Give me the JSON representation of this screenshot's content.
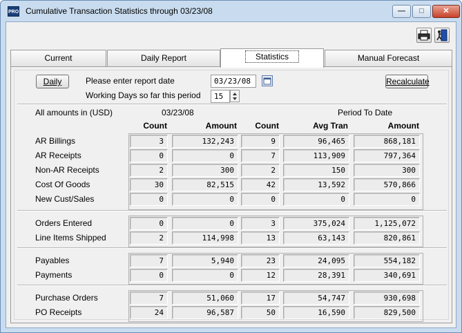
{
  "window": {
    "title": "Cumulative Transaction Statistics through 03/23/08",
    "app_icon_text": "PRO"
  },
  "tabs": [
    {
      "label": "Current"
    },
    {
      "label": "Daily Report"
    },
    {
      "label": "Statistics"
    },
    {
      "label": "Manual Forecast"
    }
  ],
  "active_tab": "Statistics",
  "controls": {
    "daily_button": "Daily",
    "report_date_label": "Please enter report date",
    "report_date_value": "03/23/08",
    "working_days_label": "Working Days so far this period",
    "working_days_value": "15",
    "recalculate_button": "Recalculate"
  },
  "headers": {
    "currency_label": "All amounts in (USD)",
    "date_label": "03/23/08",
    "period_label": "Period To Date",
    "count": "Count",
    "amount": "Amount",
    "count2": "Count",
    "avg_tran": "Avg Tran",
    "amount2": "Amount"
  },
  "groups": [
    {
      "rows": [
        {
          "label": "AR Billings",
          "count": "3",
          "amount": "132,243",
          "ptd_count": "9",
          "avg_tran": "96,465",
          "ptd_amount": "868,181"
        },
        {
          "label": "AR Receipts",
          "count": "0",
          "amount": "0",
          "ptd_count": "7",
          "avg_tran": "113,909",
          "ptd_amount": "797,364"
        },
        {
          "label": "Non-AR Receipts",
          "count": "2",
          "amount": "300",
          "ptd_count": "2",
          "avg_tran": "150",
          "ptd_amount": "300"
        },
        {
          "label": "Cost Of Goods",
          "count": "30",
          "amount": "82,515",
          "ptd_count": "42",
          "avg_tran": "13,592",
          "ptd_amount": "570,866"
        },
        {
          "label": "New Cust/Sales",
          "count": "0",
          "amount": "0",
          "ptd_count": "0",
          "avg_tran": "0",
          "ptd_amount": "0"
        }
      ]
    },
    {
      "rows": [
        {
          "label": "Orders Entered",
          "count": "0",
          "amount": "0",
          "ptd_count": "3",
          "avg_tran": "375,024",
          "ptd_amount": "1,125,072"
        },
        {
          "label": "Line Items Shipped",
          "count": "2",
          "amount": "114,998",
          "ptd_count": "13",
          "avg_tran": "63,143",
          "ptd_amount": "820,861"
        }
      ]
    },
    {
      "rows": [
        {
          "label": "Payables",
          "count": "7",
          "amount": "5,940",
          "ptd_count": "23",
          "avg_tran": "24,095",
          "ptd_amount": "554,182"
        },
        {
          "label": "Payments",
          "count": "0",
          "amount": "0",
          "ptd_count": "12",
          "avg_tran": "28,391",
          "ptd_amount": "340,691"
        }
      ]
    },
    {
      "rows": [
        {
          "label": "Purchase Orders",
          "count": "7",
          "amount": "51,060",
          "ptd_count": "17",
          "avg_tran": "54,747",
          "ptd_amount": "930,698"
        },
        {
          "label": "PO Receipts",
          "count": "24",
          "amount": "96,587",
          "ptd_count": "50",
          "avg_tran": "16,590",
          "ptd_amount": "829,500"
        }
      ]
    }
  ]
}
